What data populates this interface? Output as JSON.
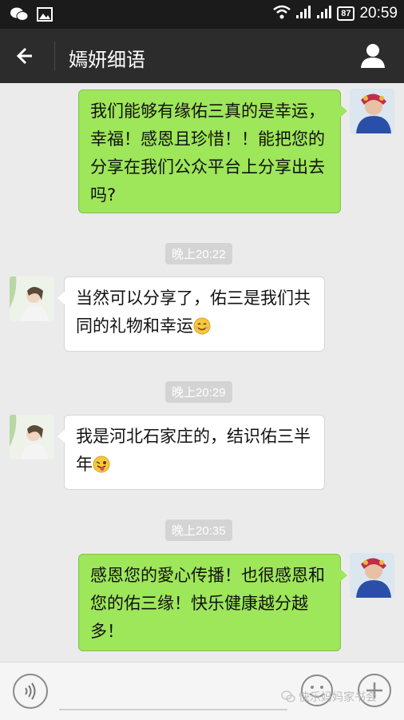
{
  "status_bar": {
    "time": "20:59",
    "battery": "87"
  },
  "header": {
    "title": "嫣妍细语"
  },
  "messages": [
    {
      "sender": "me",
      "text": "我们能够有缘佑三真的是幸运，幸福！感恩且珍惜！！能把您的分享在我们公众平台上分享出去吗?"
    },
    {
      "timestamp": "晚上20:22"
    },
    {
      "sender": "other",
      "text": "当然可以分享了，佑三是我们共同的礼物和幸运",
      "emoji": "smile-emoji"
    },
    {
      "timestamp": "晚上20:29"
    },
    {
      "sender": "other",
      "text": "我是河北石家庄的，结识佑三半年",
      "emoji": "wink-tongue-emoji"
    },
    {
      "timestamp": "晚上20:35"
    },
    {
      "sender": "me",
      "text": "感恩您的愛心传播！也很感恩和您的佑三缘！快乐健康越分越多！"
    }
  ],
  "watermark": "快乐妈妈家书会",
  "colors": {
    "my_bubble": "#9ee65a",
    "their_bubble": "#ffffff",
    "title_bar": "#2c2c2c",
    "status_bar": "#1b1b1b"
  }
}
